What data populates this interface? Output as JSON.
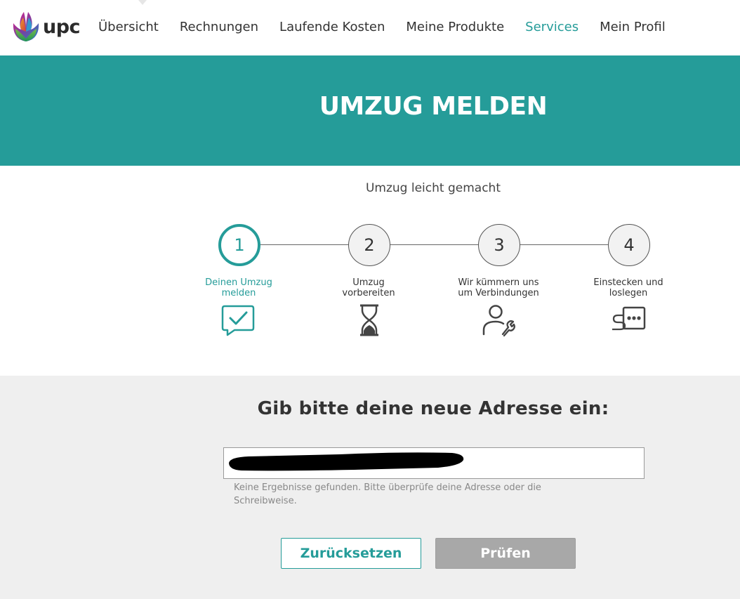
{
  "header": {
    "logo_text": "upc",
    "logo_icon": "upc-tulip-logo",
    "nav": [
      {
        "label": "Übersicht",
        "active": false
      },
      {
        "label": "Rechnungen",
        "active": false
      },
      {
        "label": "Laufende Kosten",
        "active": false
      },
      {
        "label": "Meine Produkte",
        "active": false
      },
      {
        "label": "Services",
        "active": true
      },
      {
        "label": "Mein Profil",
        "active": false
      }
    ]
  },
  "banner": {
    "title": "UMZUG MELDEN"
  },
  "steps": {
    "subtitle": "Umzug leicht gemacht",
    "items": [
      {
        "number": "1",
        "label_line1": "Deinen Umzug",
        "label_line2": "melden",
        "icon": "speech-bubble-check-icon",
        "active": true
      },
      {
        "number": "2",
        "label_line1": "Umzug",
        "label_line2": "vorbereiten",
        "icon": "hourglass-icon",
        "active": false
      },
      {
        "number": "3",
        "label_line1": "Wir kümmern uns",
        "label_line2": "um Verbindungen",
        "icon": "technician-wrench-icon",
        "active": false
      },
      {
        "number": "4",
        "label_line1": "Einstecken und",
        "label_line2": "loslegen",
        "icon": "plug-socket-icon",
        "active": false
      }
    ]
  },
  "form": {
    "heading": "Gib bitte deine neue Adresse ein:",
    "address_value": "",
    "hint": "Keine Ergebnisse gefunden. Bitte überprüfe deine Adresse oder die Schreibweise.",
    "reset_label": "Zurücksetzen",
    "check_label": "Prüfen"
  },
  "colors": {
    "accent": "#259c99",
    "disabled_button": "#a8a8a8",
    "form_background": "#efefef"
  }
}
